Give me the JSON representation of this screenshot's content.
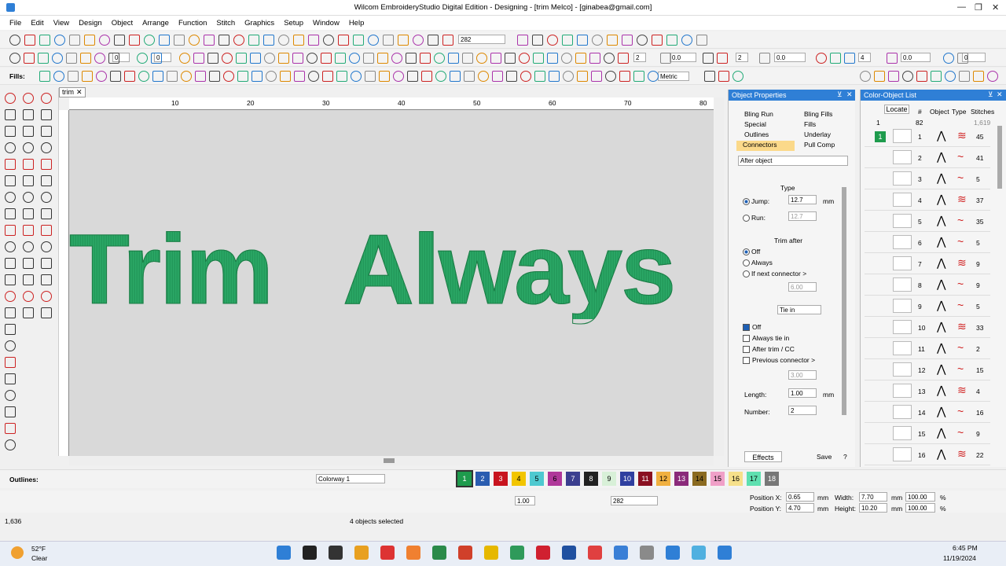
{
  "window": {
    "title": "Wilcom EmbroideryStudio Digital Edition - Designing - [trim      Melco] - [ginabea@gmail.com]"
  },
  "menu": [
    "File",
    "Edit",
    "View",
    "Design",
    "Object",
    "Arrange",
    "Function",
    "Stitch",
    "Graphics",
    "Setup",
    "Window",
    "Help"
  ],
  "toolbar": {
    "zoom_value": "282",
    "counter1": "0",
    "counter2": "0",
    "fills_label": "Fills:",
    "units": "Metric",
    "stepper_a": "2",
    "stepper_b": "0.0",
    "stepper_c": "2",
    "stepper_d": "0.0",
    "stepper_e": "4",
    "stepper_f": "0.0",
    "stepper_g": "0"
  },
  "document": {
    "tab": "trim",
    "ruler_marks": [
      "10",
      "20",
      "30",
      "40",
      "50",
      "60",
      "70",
      "80"
    ],
    "text_left": "Trim",
    "text_right": "Always"
  },
  "object_properties": {
    "title": "Object Properties",
    "tabs": [
      "Bling Run",
      "Bling Fills",
      "Special",
      "Fills",
      "Outlines",
      "Underlay",
      "Connectors",
      "Pull Comp"
    ],
    "dropdown": "After object",
    "type_label": "Type",
    "jump_label": "Jump:",
    "jump_value": "12.7",
    "run_label": "Run:",
    "run_value": "12.7",
    "unit_mm": "mm",
    "trim_after_label": "Trim after",
    "trim_options": [
      "Off",
      "Always",
      "If next connector >"
    ],
    "trim_value": "6.00",
    "tie_in_label": "Tie in",
    "tie_options": [
      "Off",
      "Always tie in",
      "After trim / CC",
      "Previous connector >"
    ],
    "tie_value": "3.00",
    "length_label": "Length:",
    "length_value": "1.00",
    "number_label": "Number:",
    "number_value": "2",
    "effects_button": "Effects",
    "save_button": "Save",
    "help_button": "?"
  },
  "color_object_list": {
    "title": "Color-Object List",
    "columns": [
      "Locate",
      "#",
      "Object",
      "Type",
      "Stitches"
    ],
    "total_row": {
      "index": "1",
      "count": "82",
      "stitches": "1,619"
    },
    "group": "1",
    "rows": [
      {
        "n": "1",
        "s": "45"
      },
      {
        "n": "2",
        "s": "41"
      },
      {
        "n": "3",
        "s": "5"
      },
      {
        "n": "4",
        "s": "37"
      },
      {
        "n": "5",
        "s": "35"
      },
      {
        "n": "6",
        "s": "5"
      },
      {
        "n": "7",
        "s": "9"
      },
      {
        "n": "8",
        "s": "9"
      },
      {
        "n": "9",
        "s": "5"
      },
      {
        "n": "10",
        "s": "33"
      },
      {
        "n": "11",
        "s": "2"
      },
      {
        "n": "12",
        "s": "15"
      },
      {
        "n": "13",
        "s": "4"
      },
      {
        "n": "14",
        "s": "16"
      },
      {
        "n": "15",
        "s": "9"
      },
      {
        "n": "16",
        "s": "22"
      }
    ]
  },
  "bottom_toolbar": {
    "outlines_label": "Outlines:",
    "colorway": "Colorway 1",
    "scale_value": "1.00",
    "zoom_value": "282",
    "swatches": [
      {
        "n": "1",
        "c": "#1e9b4d"
      },
      {
        "n": "2",
        "c": "#2a5db0"
      },
      {
        "n": "3",
        "c": "#c8141e"
      },
      {
        "n": "4",
        "c": "#f2c500"
      },
      {
        "n": "5",
        "c": "#4ec9d0"
      },
      {
        "n": "6",
        "c": "#b0389a"
      },
      {
        "n": "7",
        "c": "#3b3f8f"
      },
      {
        "n": "8",
        "c": "#222222"
      },
      {
        "n": "9",
        "c": "#d8f0d8"
      },
      {
        "n": "10",
        "c": "#2f3f9f"
      },
      {
        "n": "11",
        "c": "#8a1020"
      },
      {
        "n": "12",
        "c": "#f0b040"
      },
      {
        "n": "13",
        "c": "#8a2a7a"
      },
      {
        "n": "14",
        "c": "#8a6a20"
      },
      {
        "n": "15",
        "c": "#f0a0c8"
      },
      {
        "n": "16",
        "c": "#f6e08a"
      },
      {
        "n": "17",
        "c": "#5ee0b0"
      },
      {
        "n": "18",
        "c": "#777777"
      }
    ],
    "position_x_label": "Position X:",
    "position_x": "0.65",
    "position_y_label": "Position Y:",
    "position_y": "4.70",
    "width_label": "Width:",
    "width": "7.70",
    "height_label": "Height:",
    "height": "10.20",
    "pct_w": "100.00",
    "pct_h": "100.00",
    "unit": "mm",
    "pct": "%"
  },
  "status": {
    "stitch_count": "1,636",
    "selection": "4 objects selected"
  },
  "taskbar": {
    "temp": "52°F",
    "weather": "Clear",
    "time": "6:45 PM",
    "date": "11/19/2024"
  },
  "colors": {
    "stitch_green": "#1f9a5a",
    "accent_blue": "#2f7fd6"
  }
}
